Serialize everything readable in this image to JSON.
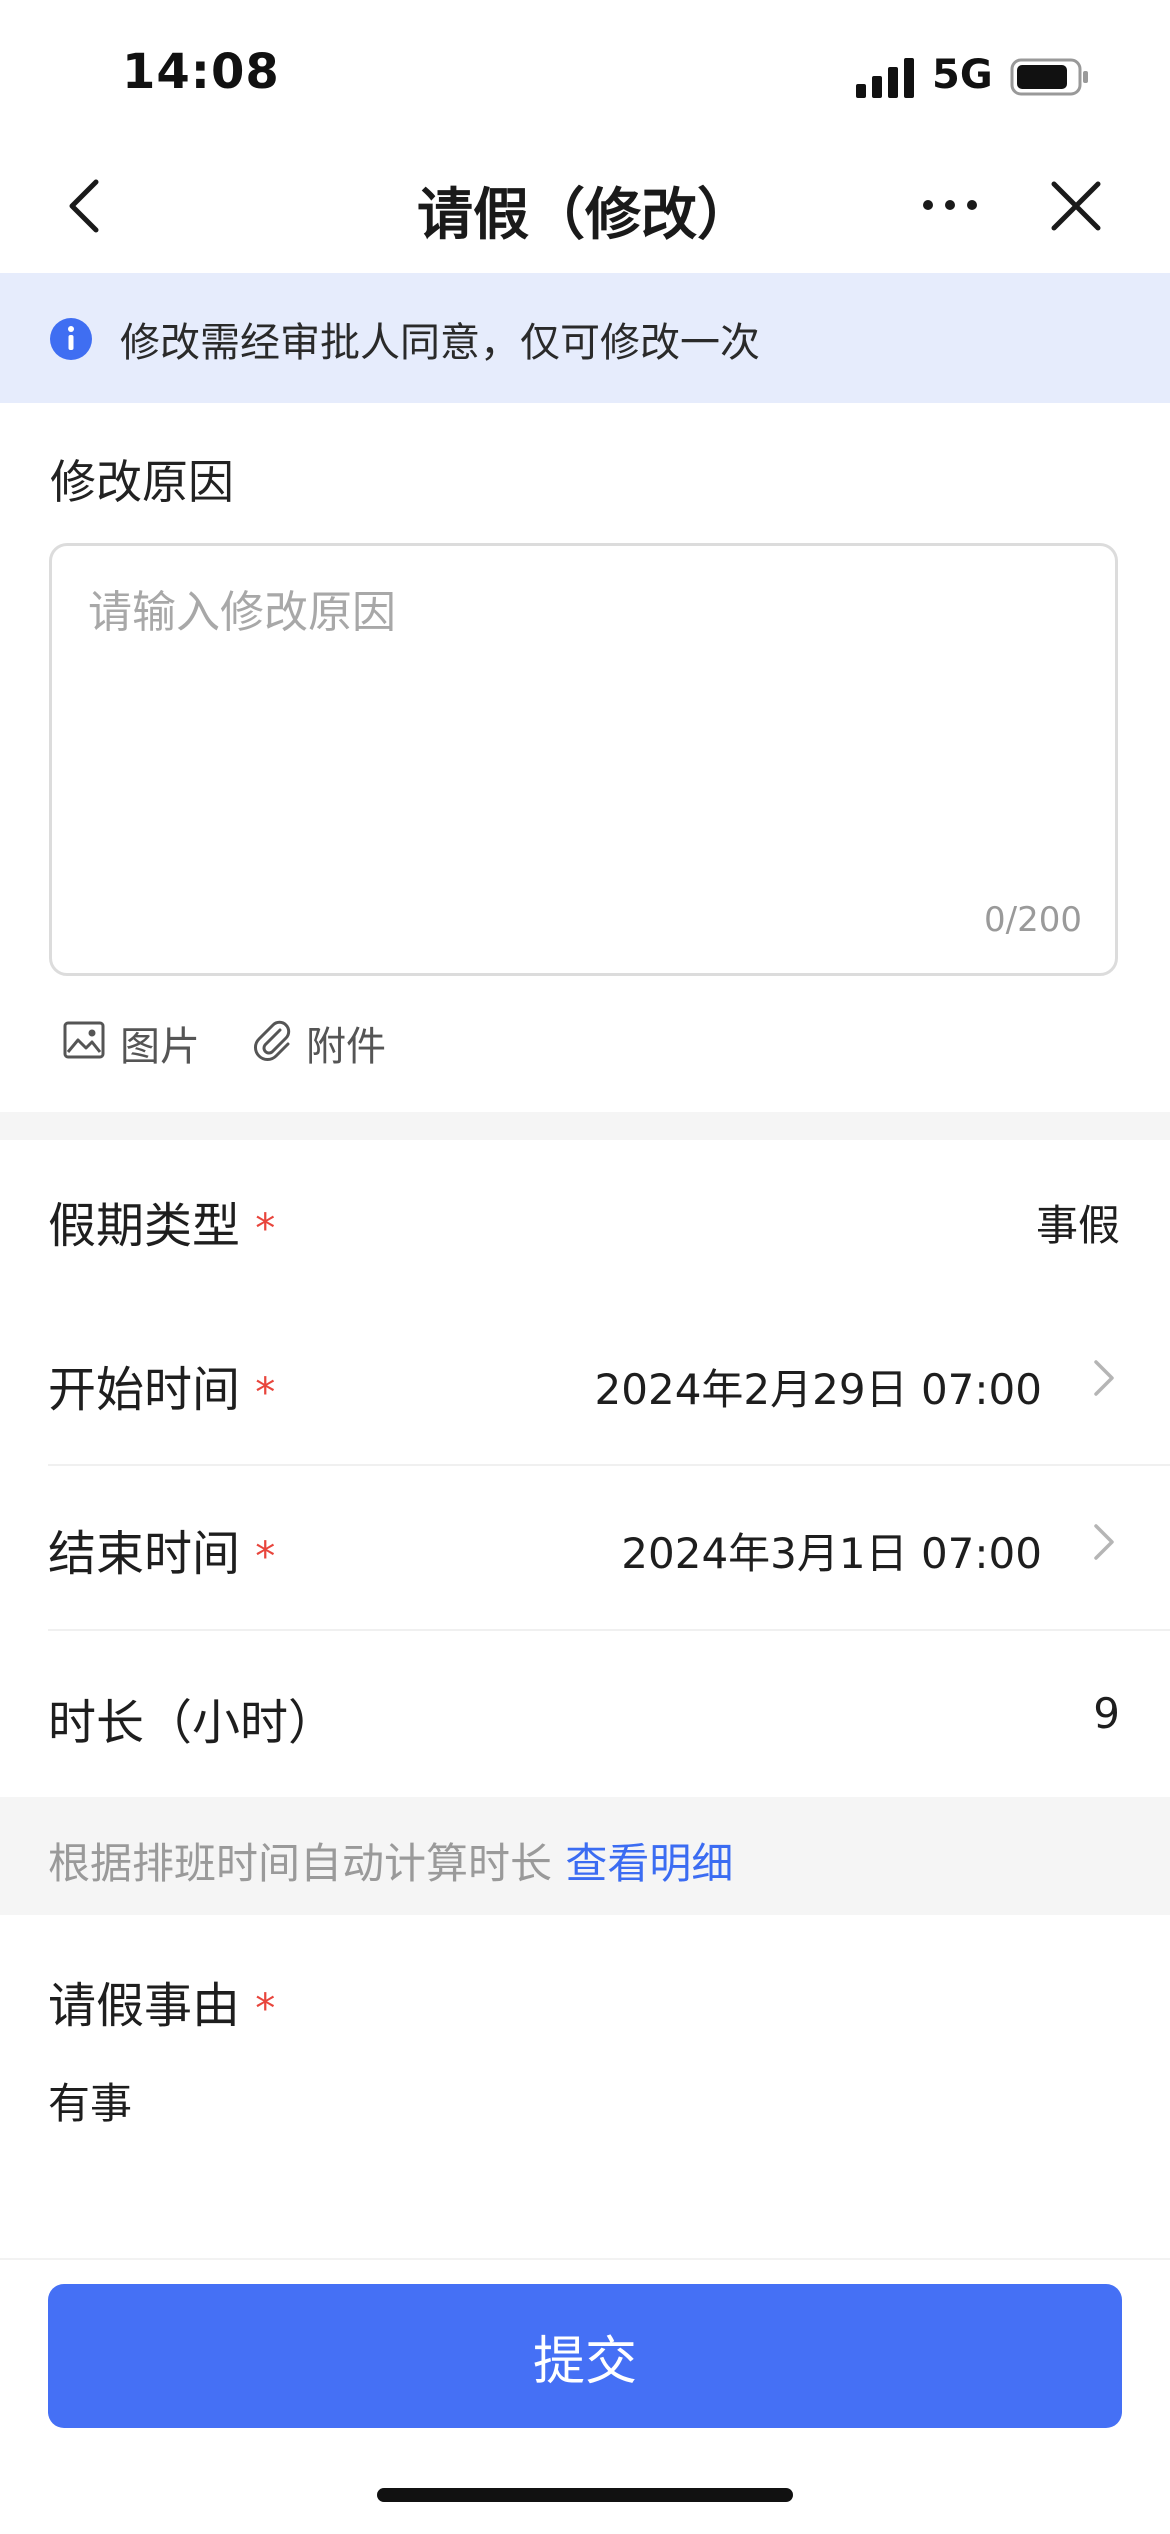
{
  "status_bar": {
    "time": "14:08",
    "network": "5G"
  },
  "nav": {
    "title": "请假（修改）"
  },
  "notice": {
    "text": "修改需经审批人同意，仅可修改一次"
  },
  "reason": {
    "label": "修改原因",
    "placeholder": "请输入修改原因",
    "counter": "0/200"
  },
  "attachments": {
    "image_label": "图片",
    "file_label": "附件"
  },
  "form": {
    "leave_type": {
      "label": "假期类型",
      "required_mark": "*",
      "value": "事假"
    },
    "start_time": {
      "label": "开始时间",
      "required_mark": "*",
      "value": "2024年2月29日 07:00"
    },
    "end_time": {
      "label": "结束时间",
      "required_mark": "*",
      "value": "2024年3月1日 07:00"
    },
    "duration": {
      "label": "时长（小时）",
      "value": "9"
    }
  },
  "hint": {
    "text": "根据排班时间自动计算时长",
    "link": "查看明细"
  },
  "leave_reason": {
    "label": "请假事由",
    "required_mark": "*",
    "value": "有事"
  },
  "submit": {
    "label": "提交"
  },
  "colors": {
    "accent": "#4570f5",
    "notice_bg": "#e6ecfc",
    "required": "#e8453c",
    "link": "#3b6cf2"
  }
}
